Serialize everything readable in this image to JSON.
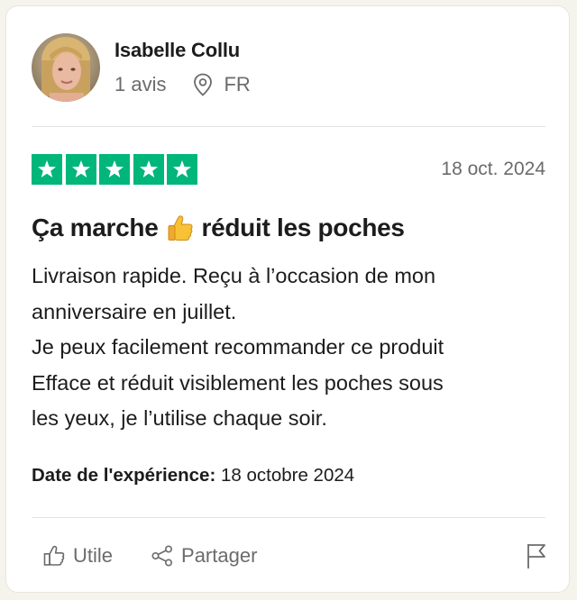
{
  "reviewer": {
    "name": "Isabelle Collu",
    "review_count": "1 avis",
    "country": "FR"
  },
  "review": {
    "rating": 5,
    "date": "18 oct. 2024",
    "title_before_emoji": "Ça marche",
    "title_after_emoji": "réduit les poches",
    "body_lines": [
      "Livraison rapide. Reçu à l’occasion de mon",
      "anniversaire en juillet.",
      "Je peux facilement recommander ce produit",
      "Efface et réduit visiblement les poches sous",
      "les yeux, je l’utilise chaque soir."
    ],
    "experience_label": "Date de l'expérience:",
    "experience_date": "18 octobre 2024"
  },
  "actions": {
    "useful_label": "Utile",
    "share_label": "Partager"
  },
  "colors": {
    "star_green": "#00b67a",
    "muted_text": "#6b6b6b",
    "text": "#1c1c1c"
  },
  "icons": [
    "location-pin-icon",
    "star-icon",
    "thumbs-up-emoji",
    "thumbs-up-icon",
    "share-icon",
    "flag-icon"
  ]
}
